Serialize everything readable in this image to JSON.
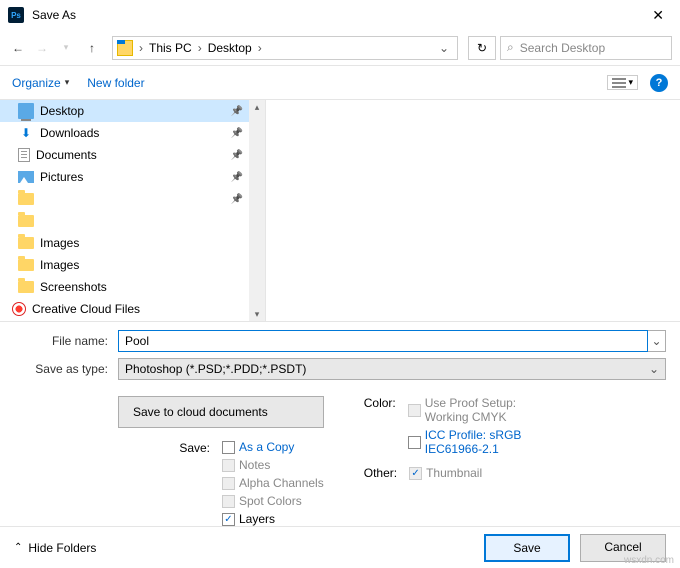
{
  "title": "Save As",
  "breadcrumb": {
    "part1": "This PC",
    "part2": "Desktop"
  },
  "search": {
    "placeholder": "Search Desktop"
  },
  "toolbar": {
    "organize": "Organize",
    "newfolder": "New folder"
  },
  "tree": {
    "items": [
      {
        "label": "Desktop",
        "icon": "desktop",
        "pin": true,
        "selected": true
      },
      {
        "label": "Downloads",
        "icon": "down",
        "pin": true
      },
      {
        "label": "Documents",
        "icon": "doc",
        "pin": true
      },
      {
        "label": "Pictures",
        "icon": "pic",
        "pin": true
      },
      {
        "label": "",
        "icon": "folder",
        "pin": true
      },
      {
        "label": "",
        "icon": "folder"
      },
      {
        "label": "Images",
        "icon": "folder"
      },
      {
        "label": "Images",
        "icon": "folder"
      },
      {
        "label": "Screenshots",
        "icon": "folder"
      },
      {
        "label": "Creative Cloud Files",
        "icon": "cc",
        "indent": -6
      }
    ]
  },
  "form": {
    "filename_label": "File name:",
    "filename_value": "Pool",
    "saveas_label": "Save as type:",
    "saveas_value": "Photoshop (*.PSD;*.PDD;*.PSDT)"
  },
  "options": {
    "cloud_btn": "Save to cloud documents",
    "save_label": "Save:",
    "asacopy": "As a Copy",
    "notes": "Notes",
    "alpha": "Alpha Channels",
    "spot": "Spot Colors",
    "layers": "Layers",
    "color_label": "Color:",
    "proof1": "Use Proof Setup:",
    "proof2": "Working CMYK",
    "icc1": "ICC Profile:  sRGB",
    "icc2": "IEC61966-2.1",
    "other_label": "Other:",
    "thumbnail": "Thumbnail"
  },
  "footer": {
    "hide": "Hide Folders",
    "save": "Save",
    "cancel": "Cancel"
  },
  "watermark": "wsxdn.com"
}
